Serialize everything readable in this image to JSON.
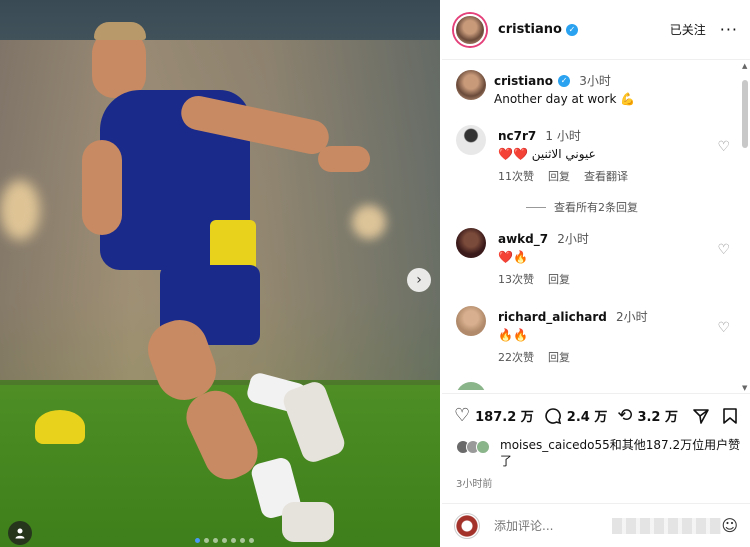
{
  "post": {
    "username": "cristiano",
    "follow_label": "已关注",
    "more_label": "···"
  },
  "caption": {
    "username": "cristiano",
    "time": "3小时",
    "text": "Another day at work 💪"
  },
  "comments": [
    {
      "username": "nc7r7",
      "time": "1 小时",
      "text": "❤️❤️ عيوني الاثنين",
      "likes": "11次赞",
      "reply": "回复",
      "translate": "查看翻译",
      "avatar_color": "#e8e8e8"
    },
    {
      "username": "awkd_7",
      "time": "2小时",
      "text": "❤️🔥",
      "likes": "13次赞",
      "reply": "回复",
      "avatar_color": "#3a1a1a"
    },
    {
      "username": "richard_alichard",
      "time": "2小时",
      "text": "🔥🔥",
      "likes": "22次赞",
      "reply": "回复",
      "avatar_color": "#b08a6a"
    }
  ],
  "view_replies": "查看所有2条回复",
  "actions": {
    "likes_count": "187.2 万",
    "comments_count": "2.4 万",
    "shares_count": "3.2 万"
  },
  "liked_by": {
    "text": "moises_caicedo55和其他187.2万位用户赞了"
  },
  "posted_ago": "3小时前",
  "compose": {
    "placeholder": "添加评论..."
  },
  "icons": {
    "heart": "heart-icon",
    "comment": "comment-icon",
    "share": "share-icon",
    "send": "send-icon",
    "save": "bookmark-icon",
    "emoji": "emoji-icon"
  },
  "colors": {
    "verified": "#2aa2f0",
    "story_ring": "#e4407a",
    "heart_red": "#e0245e"
  }
}
